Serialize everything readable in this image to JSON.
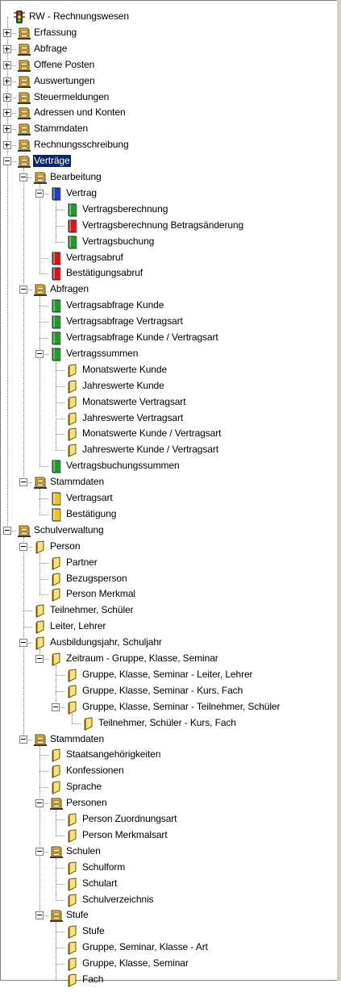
{
  "tree": [
    {
      "label": "RW - Rechnungswesen",
      "icon": "traffic-light-icon",
      "depth": 0
    },
    {
      "label": "Erfassung",
      "icon": "cabinet-icon",
      "depth": 0,
      "toggle": "+"
    },
    {
      "label": "Abfrage",
      "icon": "cabinet-icon",
      "depth": 0,
      "toggle": "+"
    },
    {
      "label": "Offene Posten",
      "icon": "cabinet-icon",
      "depth": 0,
      "toggle": "+"
    },
    {
      "label": "Auswertungen",
      "icon": "cabinet-icon",
      "depth": 0,
      "toggle": "+"
    },
    {
      "label": "Steuermeldungen",
      "icon": "cabinet-icon",
      "depth": 0,
      "toggle": "+"
    },
    {
      "label": "Adressen und Konten",
      "icon": "cabinet-icon",
      "depth": 0,
      "toggle": "+"
    },
    {
      "label": "Stammdaten",
      "icon": "cabinet-icon",
      "depth": 0,
      "toggle": "+"
    },
    {
      "label": "Rechnungsschreibung",
      "icon": "cabinet-icon",
      "depth": 0,
      "toggle": "+"
    },
    {
      "label": "Verträge",
      "icon": "cabinet-open-icon",
      "depth": 0,
      "toggle": "-",
      "selected": true
    },
    {
      "label": "Bearbeitung",
      "icon": "cabinet-open-icon",
      "depth": 1,
      "toggle": "-"
    },
    {
      "label": "Vertrag",
      "icon": "book-blue-icon",
      "depth": 2,
      "toggle": "-"
    },
    {
      "label": "Vertragsberechnung",
      "icon": "book-green-icon",
      "depth": 3
    },
    {
      "label": "Vertragsberechnung Betragsänderung",
      "icon": "book-red-icon",
      "depth": 3
    },
    {
      "label": "Vertragsbuchung",
      "icon": "book-green-icon",
      "depth": 3
    },
    {
      "label": "Vertragsabruf",
      "icon": "book-red-icon",
      "depth": 2
    },
    {
      "label": "Bestätigungsabruf",
      "icon": "book-red-icon",
      "depth": 2
    },
    {
      "label": "Abfragen",
      "icon": "cabinet-open-icon",
      "depth": 1,
      "toggle": "-"
    },
    {
      "label": "Vertragsabfrage Kunde",
      "icon": "book-green-icon",
      "depth": 2
    },
    {
      "label": "Vertragsabfrage Vertragsart",
      "icon": "book-green-icon",
      "depth": 2
    },
    {
      "label": "Vertragsabfrage Kunde / Vertragsart",
      "icon": "book-green-icon",
      "depth": 2
    },
    {
      "label": "Vertragssummen",
      "icon": "book-green-icon",
      "depth": 2,
      "toggle": "-"
    },
    {
      "label": "Monatswerte Kunde",
      "icon": "folder-icon",
      "depth": 3
    },
    {
      "label": "Jahreswerte Kunde",
      "icon": "folder-icon",
      "depth": 3
    },
    {
      "label": "Monatswerte Vertragsart",
      "icon": "folder-icon",
      "depth": 3
    },
    {
      "label": "Jahreswerte Vertragsart",
      "icon": "folder-icon",
      "depth": 3
    },
    {
      "label": "Monatswerte Kunde / Vertragsart",
      "icon": "folder-icon",
      "depth": 3
    },
    {
      "label": "Jahreswerte Kunde / Vertragsart",
      "icon": "folder-icon",
      "depth": 3
    },
    {
      "label": "Vertragsbuchungssummen",
      "icon": "book-green-icon",
      "depth": 2
    },
    {
      "label": "Stammdaten",
      "icon": "cabinet-open-icon",
      "depth": 1,
      "toggle": "-"
    },
    {
      "label": "Vertragsart",
      "icon": "book-yellow-icon",
      "depth": 2
    },
    {
      "label": "Bestätigung",
      "icon": "book-yellow-icon",
      "depth": 2
    },
    {
      "label": "Schulverwaltung",
      "icon": "cabinet-open-icon",
      "depth": 0,
      "toggle": "-"
    },
    {
      "label": "Person",
      "icon": "folder-icon",
      "depth": 1,
      "toggle": "-"
    },
    {
      "label": "Partner",
      "icon": "folder-icon",
      "depth": 2
    },
    {
      "label": "Bezugsperson",
      "icon": "folder-icon",
      "depth": 2
    },
    {
      "label": "Person Merkmal",
      "icon": "folder-icon",
      "depth": 2
    },
    {
      "label": "Teilnehmer, Schüler",
      "icon": "folder-icon",
      "depth": 1
    },
    {
      "label": "Leiter, Lehrer",
      "icon": "folder-icon",
      "depth": 1
    },
    {
      "label": "Ausbildungsjahr, Schuljahr",
      "icon": "folder-icon",
      "depth": 1,
      "toggle": "-"
    },
    {
      "label": "Zeitraum - Gruppe, Klasse, Seminar",
      "icon": "folder-icon",
      "depth": 2,
      "toggle": "-"
    },
    {
      "label": "Gruppe, Klasse, Seminar - Leiter, Lehrer",
      "icon": "folder-icon",
      "depth": 3
    },
    {
      "label": "Gruppe, Klasse, Seminar - Kurs, Fach",
      "icon": "folder-icon",
      "depth": 3
    },
    {
      "label": "Gruppe, Klasse, Seminar - Teilnehmer, Schüler",
      "icon": "folder-icon",
      "depth": 3,
      "toggle": "-"
    },
    {
      "label": "Teilnehmer, Schüler - Kurs, Fach",
      "icon": "folder-icon",
      "depth": 4
    },
    {
      "label": "Stammdaten",
      "icon": "cabinet-open-icon",
      "depth": 1,
      "toggle": "-"
    },
    {
      "label": "Staatsangehörigkeiten",
      "icon": "folder-icon",
      "depth": 2
    },
    {
      "label": "Konfessionen",
      "icon": "folder-icon",
      "depth": 2
    },
    {
      "label": "Sprache",
      "icon": "folder-icon",
      "depth": 2
    },
    {
      "label": "Personen",
      "icon": "cabinet-open-icon",
      "depth": 2,
      "toggle": "-"
    },
    {
      "label": "Person Zuordnungsart",
      "icon": "folder-icon",
      "depth": 3
    },
    {
      "label": "Person Merkmalsart",
      "icon": "folder-icon",
      "depth": 3
    },
    {
      "label": "Schulen",
      "icon": "cabinet-open-icon",
      "depth": 2,
      "toggle": "-"
    },
    {
      "label": "Schulform",
      "icon": "folder-icon",
      "depth": 3
    },
    {
      "label": "Schulart",
      "icon": "folder-icon",
      "depth": 3
    },
    {
      "label": "Schulverzeichnis",
      "icon": "folder-icon",
      "depth": 3
    },
    {
      "label": "Stufe",
      "icon": "cabinet-open-icon",
      "depth": 2,
      "toggle": "-"
    },
    {
      "label": "Stufe",
      "icon": "folder-icon",
      "depth": 3
    },
    {
      "label": "Gruppe, Seminar, Klasse - Art",
      "icon": "folder-icon",
      "depth": 3
    },
    {
      "label": "Gruppe, Klasse, Seminar",
      "icon": "folder-icon",
      "depth": 3
    },
    {
      "label": "Fach",
      "icon": "folder-icon",
      "depth": 3
    }
  ],
  "colors": {
    "selection": "#0a246a",
    "folder": "#f6e27a",
    "cabinet": "#e8b84a"
  }
}
